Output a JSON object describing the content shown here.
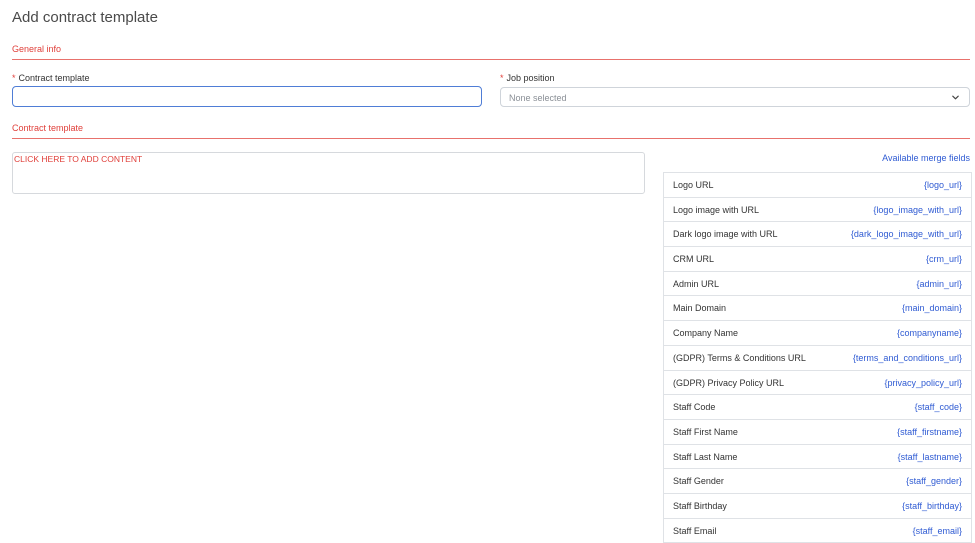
{
  "page": {
    "title": "Add contract template"
  },
  "sections": {
    "general_info": "General info",
    "contract_template": "Contract template"
  },
  "form": {
    "contract_template_label": "Contract template",
    "contract_template_value": "",
    "job_position_label": "Job position",
    "job_position_value": "None selected",
    "required_marker": "*"
  },
  "editor": {
    "placeholder": "CLICK HERE TO ADD CONTENT"
  },
  "merge_fields": {
    "title": "Available merge fields",
    "items": [
      {
        "label": "Logo URL",
        "key": "{logo_url}"
      },
      {
        "label": "Logo image with URL",
        "key": "{logo_image_with_url}"
      },
      {
        "label": "Dark logo image with URL",
        "key": "{dark_logo_image_with_url}"
      },
      {
        "label": "CRM URL",
        "key": "{crm_url}"
      },
      {
        "label": "Admin URL",
        "key": "{admin_url}"
      },
      {
        "label": "Main Domain",
        "key": "{main_domain}"
      },
      {
        "label": "Company Name",
        "key": "{companyname}"
      },
      {
        "label": "(GDPR) Terms & Conditions URL",
        "key": "{terms_and_conditions_url}"
      },
      {
        "label": "(GDPR) Privacy Policy URL",
        "key": "{privacy_policy_url}"
      },
      {
        "label": "Staff Code",
        "key": "{staff_code}"
      },
      {
        "label": "Staff First Name",
        "key": "{staff_firstname}"
      },
      {
        "label": "Staff Last Name",
        "key": "{staff_lastname}"
      },
      {
        "label": "Staff Gender",
        "key": "{staff_gender}"
      },
      {
        "label": "Staff Birthday",
        "key": "{staff_birthday}"
      },
      {
        "label": "Staff Email",
        "key": "{staff_email}"
      }
    ]
  },
  "colors": {
    "accent_red": "#e0403b",
    "link_blue": "#2f5bd3",
    "focus_blue": "#4f7dd6"
  }
}
